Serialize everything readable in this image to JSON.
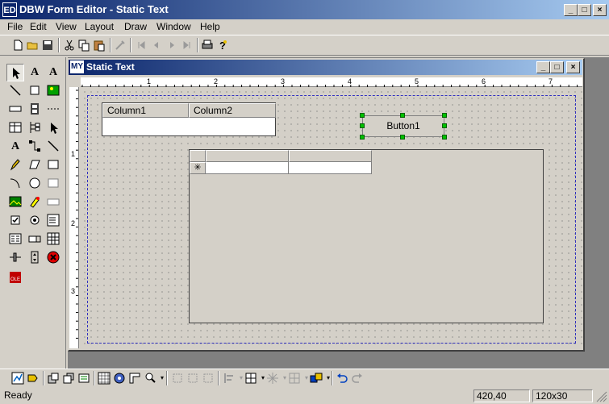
{
  "app": {
    "icon": "ED",
    "title": "DBW Form Editor - Static Text",
    "caption_buttons": {
      "minimize": "_",
      "maximize": "□",
      "close": "×"
    }
  },
  "menu": [
    "File",
    "Edit",
    "View",
    "Layout",
    "Draw",
    "Window",
    "Help"
  ],
  "toolbar": {
    "new_icon": "new-file-icon",
    "open_icon": "open-folder-icon",
    "save_icon": "save-icon",
    "cut_icon": "cut-icon",
    "copy_icon": "copy-icon",
    "paste_icon": "paste-icon",
    "run_icon": "run-icon",
    "first_icon": "first-record-icon",
    "prev_icon": "prev-record-icon",
    "next_icon": "next-record-icon",
    "last_icon": "last-record-icon",
    "print_icon": "print-icon",
    "help_icon": "help-icon"
  },
  "palette": {
    "text_tool_1": "A",
    "text_tool_2": "A",
    "text_tool_3": "A"
  },
  "child_window": {
    "icon": "MY",
    "title": "Static Text",
    "caption_buttons": {
      "minimize": "_",
      "maximize": "□",
      "close": "×"
    }
  },
  "ruler": {
    "horizontal": [
      "1",
      "2",
      "3",
      "4",
      "5",
      "6",
      "7"
    ],
    "vertical": [
      "1",
      "2",
      "3"
    ]
  },
  "form": {
    "columns": [
      "Column1",
      "Column2"
    ],
    "button_label": "Button1",
    "grid_new_row_marker": "✳"
  },
  "status": {
    "text": "Ready",
    "position": "420,40",
    "size": "120x30"
  }
}
